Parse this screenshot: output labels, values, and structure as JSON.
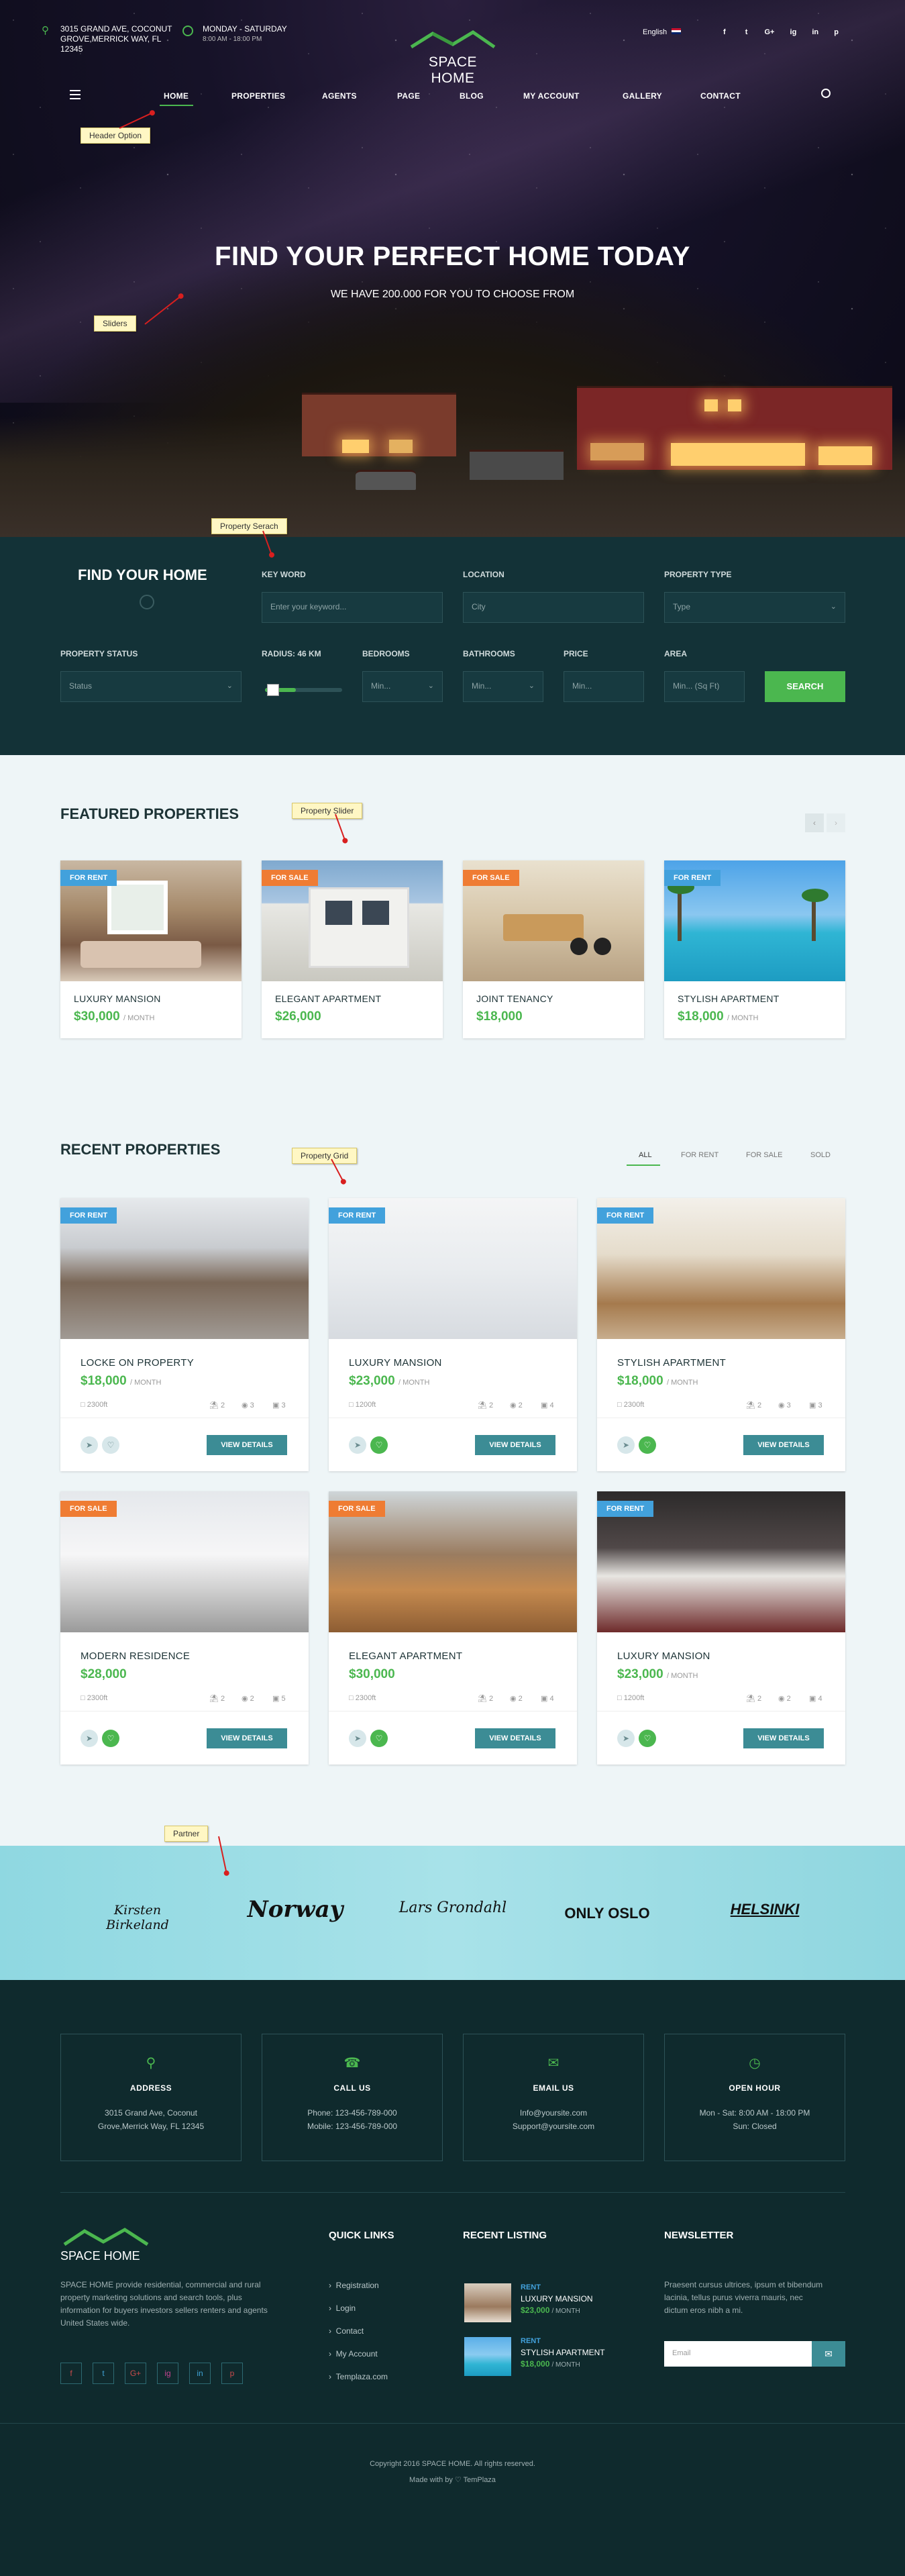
{
  "topbar": {
    "address": [
      "3015 GRAND AVE, COCONUT",
      "GROVE,MERRICK WAY, FL",
      "12345"
    ],
    "hours_title": "MONDAY - SATURDAY",
    "hours_time": "8:00 AM - 18:00 PM",
    "logo": "SPACE HOME",
    "language": "English",
    "socials": [
      "f",
      "t",
      "G+",
      "ig",
      "in",
      "p"
    ]
  },
  "nav": {
    "items": [
      "HOME",
      "PROPERTIES",
      "AGENTS",
      "PAGE",
      "BLOG",
      "MY ACCOUNT",
      "GALLERY",
      "CONTACT"
    ],
    "active": "HOME"
  },
  "hero": {
    "title": "FIND YOUR PERFECT HOME TODAY",
    "subtitle": "WE HAVE 200.000 FOR YOU TO CHOOSE FROM"
  },
  "annotations": {
    "header": "Header Option",
    "sliders": "Sliders",
    "search": "Property Serach",
    "slider": "Property Slider",
    "grid": "Property Grid",
    "partner": "Partner"
  },
  "search": {
    "title": "FIND YOUR HOME",
    "keyword_label": "KEY WORD",
    "keyword_placeholder": "Enter your keyword...",
    "location_label": "LOCATION",
    "location_value": "City",
    "type_label": "PROPERTY TYPE",
    "type_value": "Type",
    "status_label": "PROPERTY STATUS",
    "status_value": "Status",
    "radius_label": "RADIUS: 46 KM",
    "radius_fraction": 0.4,
    "bedrooms_label": "BEDROOMS",
    "bedrooms_value": "Min...",
    "bathrooms_label": "BATHROOMS",
    "bathrooms_value": "Min...",
    "price_label": "PRICE",
    "price_value": "Min...",
    "area_label": "AREA",
    "area_value": "Min... (Sq Ft)",
    "button": "SEARCH"
  },
  "featured": {
    "title": "FEATURED PROPERTIES",
    "cards": [
      {
        "badge": "FOR RENT",
        "name": "LUXURY MANSION",
        "price": "$30,000",
        "unit": "/ MONTH"
      },
      {
        "badge": "FOR SALE",
        "name": "ELEGANT APARTMENT",
        "price": "$26,000",
        "unit": ""
      },
      {
        "badge": "FOR SALE",
        "name": "JOINT TENANCY",
        "price": "$18,000",
        "unit": ""
      },
      {
        "badge": "FOR RENT",
        "name": "STYLISH APARTMENT",
        "price": "$18,000",
        "unit": "/ MONTH"
      }
    ]
  },
  "recent": {
    "title": "RECENT PROPERTIES",
    "filters": [
      "ALL",
      "FOR RENT",
      "FOR SALE",
      "SOLD"
    ],
    "button": "VIEW DETAILS",
    "cards": [
      {
        "badge": "FOR RENT",
        "name": "LOCKE ON PROPERTY",
        "price": "$18,000",
        "unit": "/ MONTH",
        "area": "2300ft",
        "car": "2",
        "bath": "3",
        "bed": "3"
      },
      {
        "badge": "FOR RENT",
        "name": "LUXURY MANSION",
        "price": "$23,000",
        "unit": "/ MONTH",
        "area": "1200ft",
        "car": "2",
        "bath": "2",
        "bed": "4"
      },
      {
        "badge": "FOR RENT",
        "name": "STYLISH APARTMENT",
        "price": "$18,000",
        "unit": "/ MONTH",
        "area": "2300ft",
        "car": "2",
        "bath": "3",
        "bed": "3"
      },
      {
        "badge": "FOR SALE",
        "name": "MODERN RESIDENCE",
        "price": "$28,000",
        "unit": "",
        "area": "2300ft",
        "car": "2",
        "bath": "2",
        "bed": "5"
      },
      {
        "badge": "FOR SALE",
        "name": "ELEGANT APARTMENT",
        "price": "$30,000",
        "unit": "",
        "area": "2300ft",
        "car": "2",
        "bath": "2",
        "bed": "4"
      },
      {
        "badge": "FOR RENT",
        "name": "LUXURY MANSION",
        "price": "$23,000",
        "unit": "/ MONTH",
        "area": "1200ft",
        "car": "2",
        "bath": "2",
        "bed": "4"
      }
    ]
  },
  "partners": [
    "Kirsten Birkeland",
    "Norway",
    "Lars Grondahl",
    "ONLY OSLO",
    "HELSINKI"
  ],
  "contact": [
    {
      "title": "ADDRESS",
      "lines": [
        "3015 Grand Ave, Coconut",
        "Grove,Merrick Way, FL 12345"
      ]
    },
    {
      "title": "CALL US",
      "lines": [
        "Phone: 123-456-789-000",
        "Mobile: 123-456-789-000"
      ]
    },
    {
      "title": "EMAIL US",
      "lines": [
        "Info@yoursite.com",
        "Support@yoursite.com"
      ]
    },
    {
      "title": "OPEN HOUR",
      "lines": [
        "Mon - Sat: 8:00 AM - 18:00 PM",
        "Sun: Closed"
      ]
    }
  ],
  "footer": {
    "logo": "SPACE HOME",
    "about": [
      "SPACE HOME provide residential, commercial and rural",
      "property marketing solutions and search tools, plus",
      "information for buyers investors sellers renters and agents",
      "United States wide."
    ],
    "quick_title": "QUICK LINKS",
    "quick_links": [
      "Registration",
      "Login",
      "Contact",
      "My Account",
      "Templaza.com"
    ],
    "recent_title": "RECENT LISTING",
    "recent": [
      {
        "tag": "RENT",
        "name": "LUXURY MANSION",
        "price": "$23,000",
        "unit": "/ MONTH"
      },
      {
        "tag": "RENT",
        "name": "STYLISH APARTMENT",
        "price": "$18,000",
        "unit": "/ MONTH"
      }
    ],
    "news_title": "NEWSLETTER",
    "news_text": [
      "Praesent cursus ultrices, ipsum et bibendum",
      "lacinia, tellus purus viverra mauris, nec",
      "dictum eros nibh a mi."
    ],
    "email_placeholder": "Email",
    "copyright": "Copyright 2016 SPACE HOME. All rights reserved.",
    "made_by": "Made with by ♡ TemPlaza"
  },
  "colors": {
    "green": "#4bb74f",
    "teal": "#3c8c95",
    "rent": "#42a1dc",
    "sale": "#ef7c33",
    "dark": "#133237"
  }
}
